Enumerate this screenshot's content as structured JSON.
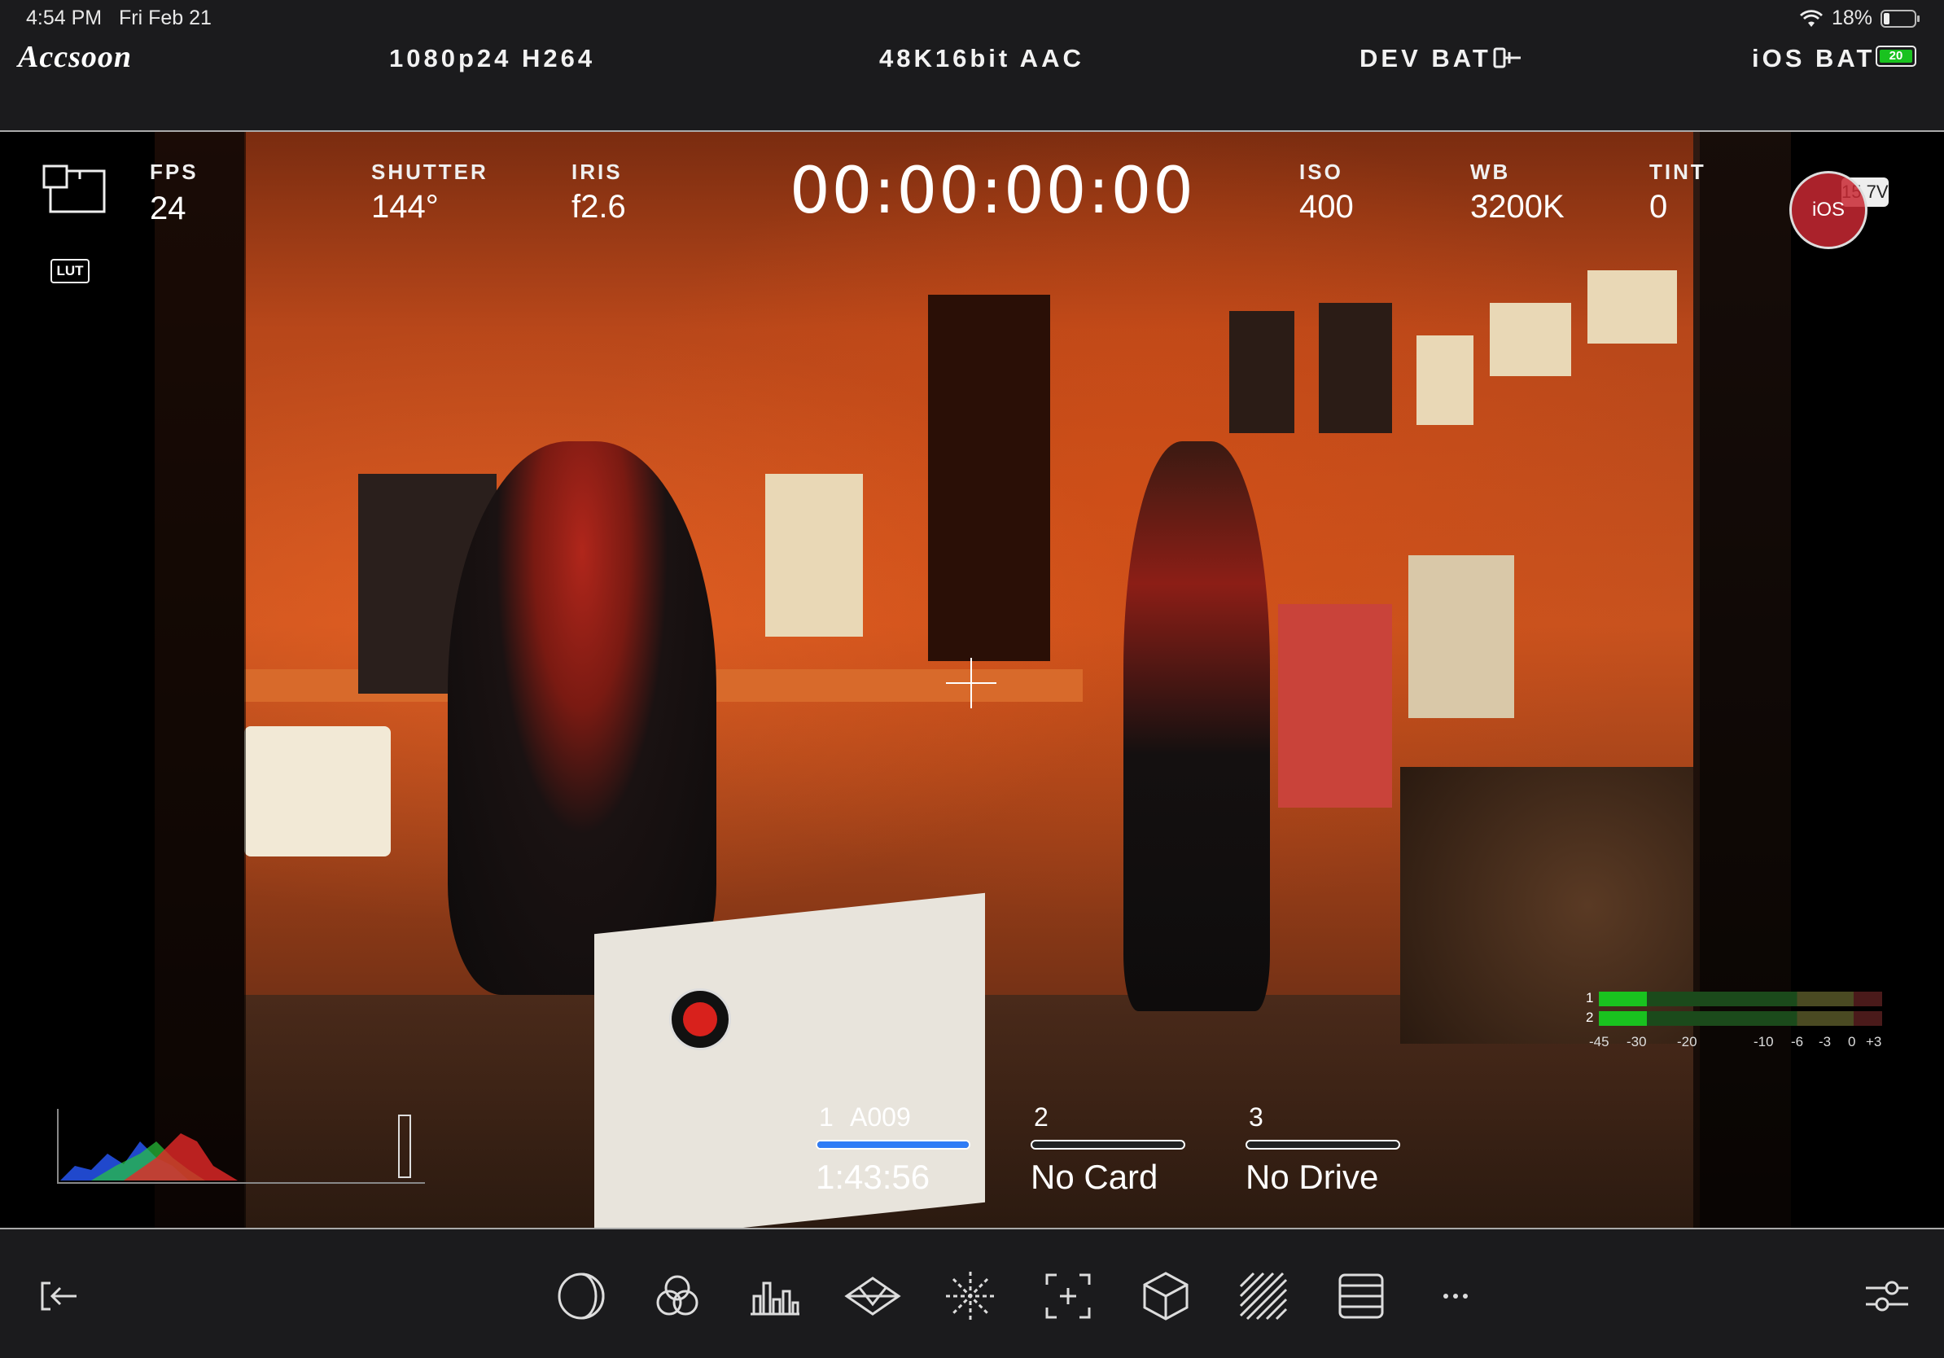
{
  "status_bar": {
    "time": "4:54 PM",
    "date": "Fri Feb 21",
    "battery_pct": "18%"
  },
  "header": {
    "logo": "Accsoon",
    "video_format": "1080p24 H264",
    "audio_format": "48K16bit AAC",
    "dev_bat_label": "DEV BAT",
    "ios_bat_label": "iOS BAT",
    "ios_bat_value": "20"
  },
  "camera": {
    "fps_label": "FPS",
    "fps_value": "24",
    "shutter_label": "SHUTTER",
    "shutter_value": "144°",
    "iris_label": "IRIS",
    "iris_value": "f2.6",
    "timecode": "00:00:00:00",
    "iso_label": "ISO",
    "iso_value": "400",
    "wb_label": "WB",
    "wb_value": "3200K",
    "tint_label": "TINT",
    "tint_value": "0"
  },
  "left_tools": {
    "lut_label": "LUT"
  },
  "ios_badge": {
    "label": "iOS",
    "voltage": "15.7V"
  },
  "media_slots": [
    {
      "num": "1",
      "clip": "A009",
      "value": "1:43:56",
      "fill": 1.0
    },
    {
      "num": "2",
      "clip": "",
      "value": "No Card",
      "fill": 0
    },
    {
      "num": "3",
      "clip": "",
      "value": "No Drive",
      "fill": 0
    }
  ],
  "audio_meter": {
    "channels": [
      "1",
      "2"
    ],
    "scale": [
      "-45",
      "-30",
      "-20",
      "-10",
      "-6",
      "-3",
      "0",
      "+3"
    ],
    "levels": [
      0.13,
      0.13
    ]
  },
  "colors": {
    "accent_blue": "#2f7cf6",
    "record_red": "#d8211c",
    "meter_green": "#19c21f"
  },
  "toolbar": {
    "icons": [
      "exit-icon",
      "false-color-icon",
      "color-channels-icon",
      "histogram-icon",
      "waveform-icon",
      "focus-peaking-icon",
      "frame-guide-icon",
      "lut-cube-icon",
      "zebra-icon",
      "grid-icon",
      "more-icon",
      "settings-sliders-icon"
    ]
  }
}
